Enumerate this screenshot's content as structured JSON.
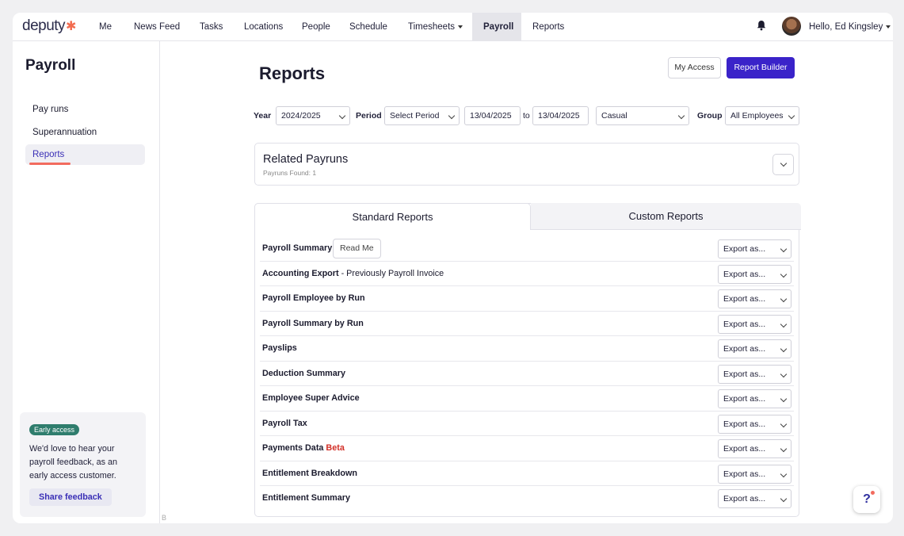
{
  "app": {
    "logo": "deputy",
    "logo_mark": "✱"
  },
  "nav": {
    "items": [
      "Me",
      "News Feed",
      "Tasks",
      "Locations",
      "People",
      "Schedule",
      "Timesheets",
      "Payroll",
      "Reports"
    ],
    "active": "Payroll",
    "greeting": "Hello, Ed Kingsley"
  },
  "sidebar": {
    "title": "Payroll",
    "items": [
      "Pay runs",
      "Superannuation",
      "Reports"
    ],
    "active": "Reports",
    "early_access": {
      "badge": "Early access",
      "text": "We'd love to hear your payroll feedback, as an early access customer.",
      "button": "Share feedback"
    },
    "footer_letter": "B"
  },
  "main": {
    "title": "Reports",
    "my_access": "My Access",
    "report_builder": "Report Builder",
    "filters": {
      "year_label": "Year",
      "year_value": "2024/2025",
      "period_label": "Period",
      "period_value": "Select Period",
      "date_from": "13/04/2025",
      "to_label": "to",
      "date_to": "13/04/2025",
      "type_value": "Casual",
      "group_label": "Group",
      "group_value": "All Employees"
    },
    "related": {
      "title": "Related Payruns",
      "subtitle": "Payruns Found: 1"
    },
    "tabs": [
      "Standard Reports",
      "Custom Reports"
    ],
    "active_tab": "Standard Reports",
    "read_me": "Read Me",
    "export_label": "Export as...",
    "reports": [
      {
        "name": "Payroll Summary",
        "suffix": "",
        "beta": ""
      },
      {
        "name": "Accounting Export",
        "suffix": " - Previously Payroll Invoice",
        "beta": ""
      },
      {
        "name": "Payroll Employee by Run",
        "suffix": "",
        "beta": ""
      },
      {
        "name": "Payroll Summary by Run",
        "suffix": "",
        "beta": ""
      },
      {
        "name": "Payslips",
        "suffix": "",
        "beta": ""
      },
      {
        "name": "Deduction Summary",
        "suffix": "",
        "beta": ""
      },
      {
        "name": "Employee Super Advice",
        "suffix": "",
        "beta": ""
      },
      {
        "name": "Payroll Tax",
        "suffix": "",
        "beta": ""
      },
      {
        "name": "Payments Data",
        "suffix": "",
        "beta": "Beta"
      },
      {
        "name": "Entitlement Breakdown",
        "suffix": "",
        "beta": ""
      },
      {
        "name": "Entitlement Summary",
        "suffix": "",
        "beta": ""
      }
    ]
  },
  "help": {
    "label": "?"
  },
  "colors": {
    "accent": "#3a23c9",
    "brand_coral": "#f26b4f",
    "early_badge": "#2f7d6d",
    "beta_red": "#d22f27"
  }
}
